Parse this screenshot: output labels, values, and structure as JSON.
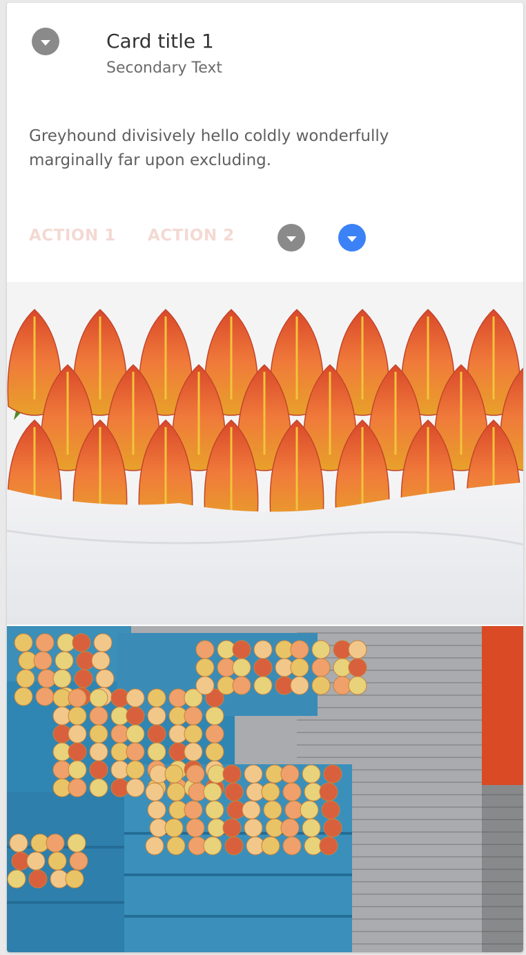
{
  "card": {
    "title": "Card title 1",
    "subtitle": "Secondary Text",
    "body": "Greyhound divisively hello coldly wonderfully marginally far upon excluding.",
    "header_icon": "chevron-down-icon",
    "actions": [
      {
        "label": "ACTION 1"
      },
      {
        "label": "ACTION 2"
      }
    ],
    "icon_buttons": [
      {
        "icon": "chevron-down-icon",
        "color": "#8a8a8a"
      },
      {
        "icon": "chevron-down-icon",
        "color": "#3b82f6"
      }
    ],
    "action_color": "#f4d9d3"
  },
  "media": [
    {
      "subject": "tulip-bouquet-image"
    },
    {
      "subject": "fruit-market-crates-image"
    }
  ]
}
